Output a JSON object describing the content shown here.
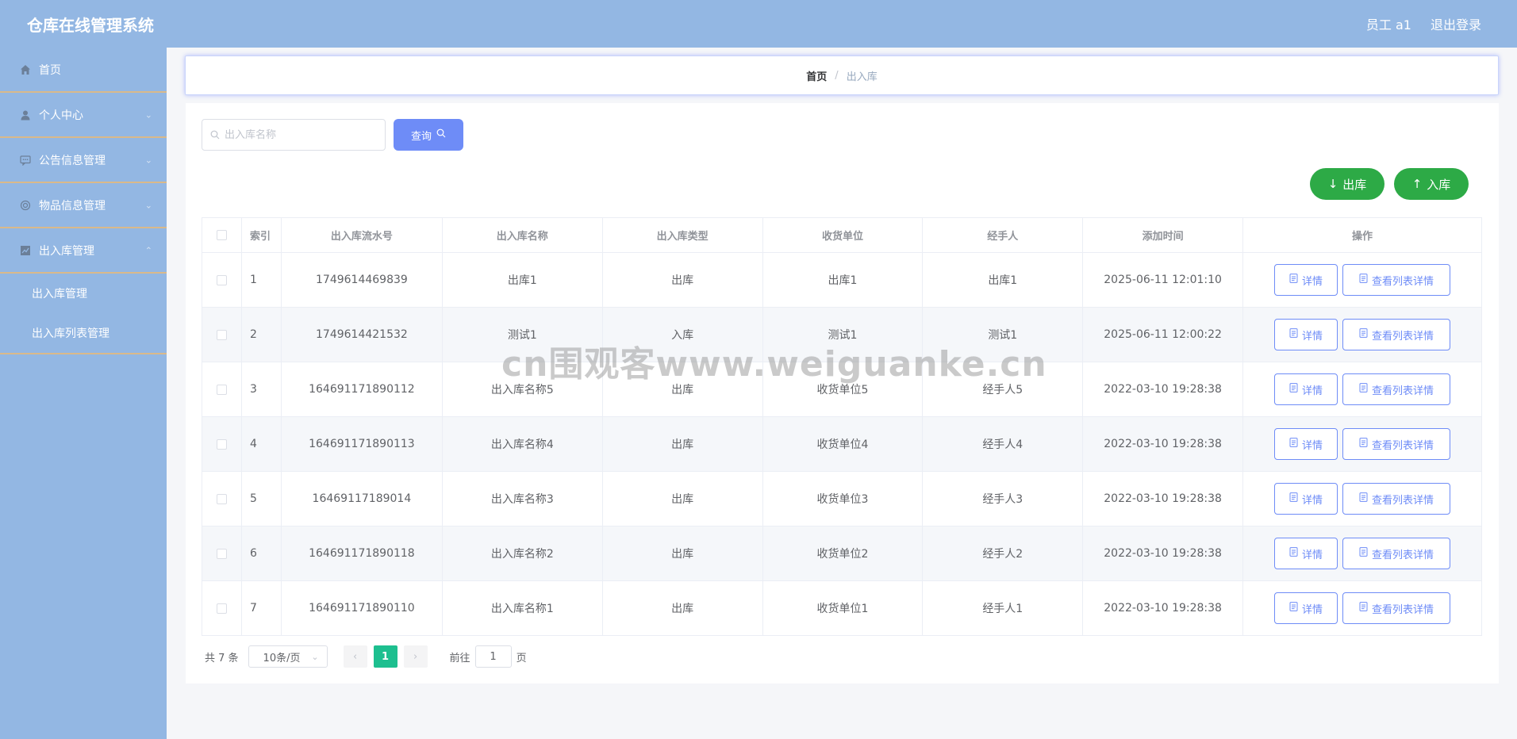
{
  "app": {
    "title": "仓库在线管理系统"
  },
  "header": {
    "user_label": "员工 a1",
    "logout_label": "退出登录"
  },
  "sidebar": {
    "items": [
      {
        "label": "首页",
        "icon": "home-icon"
      },
      {
        "label": "个人中心",
        "icon": "user-icon"
      },
      {
        "label": "公告信息管理",
        "icon": "chat-icon"
      },
      {
        "label": "物品信息管理",
        "icon": "gear-icon"
      },
      {
        "label": "出入库管理",
        "icon": "chart-icon"
      }
    ],
    "subitems": [
      {
        "label": "出入库管理"
      },
      {
        "label": "出入库列表管理"
      }
    ]
  },
  "breadcrumb": {
    "home": "首页",
    "separator": "/",
    "current": "出入库"
  },
  "search": {
    "placeholder": "出入库名称",
    "button_label": "查询"
  },
  "actions": {
    "out_label": "出库",
    "in_label": "入库"
  },
  "table": {
    "headers": [
      "索引",
      "出入库流水号",
      "出入库名称",
      "出入库类型",
      "收货单位",
      "经手人",
      "添加时间",
      "操作"
    ],
    "rows": [
      {
        "index": "1",
        "serial": "1749614469839",
        "name": "出库1",
        "type": "出库",
        "unit": "出库1",
        "handler": "出库1",
        "time": "2025-06-11 12:01:10"
      },
      {
        "index": "2",
        "serial": "1749614421532",
        "name": "测试1",
        "type": "入库",
        "unit": "测试1",
        "handler": "测试1",
        "time": "2025-06-11 12:00:22"
      },
      {
        "index": "3",
        "serial": "164691171890112",
        "name": "出入库名称5",
        "type": "出库",
        "unit": "收货单位5",
        "handler": "经手人5",
        "time": "2022-03-10 19:28:38"
      },
      {
        "index": "4",
        "serial": "164691171890113",
        "name": "出入库名称4",
        "type": "出库",
        "unit": "收货单位4",
        "handler": "经手人4",
        "time": "2022-03-10 19:28:38"
      },
      {
        "index": "5",
        "serial": "16469117189014",
        "name": "出入库名称3",
        "type": "出库",
        "unit": "收货单位3",
        "handler": "经手人3",
        "time": "2022-03-10 19:28:38"
      },
      {
        "index": "6",
        "serial": "164691171890118",
        "name": "出入库名称2",
        "type": "出库",
        "unit": "收货单位2",
        "handler": "经手人2",
        "time": "2022-03-10 19:28:38"
      },
      {
        "index": "7",
        "serial": "164691171890110",
        "name": "出入库名称1",
        "type": "出库",
        "unit": "收货单位1",
        "handler": "经手人1",
        "time": "2022-03-10 19:28:38"
      }
    ],
    "detail_label": "详情",
    "list_detail_label": "查看列表详情"
  },
  "pagination": {
    "total_text": "共 7 条",
    "page_size": "10条/页",
    "current_page": "1",
    "goto_label": "前往",
    "goto_value": "1",
    "page_suffix": "页"
  },
  "watermark": "cn围观客www.weiguanke.cn",
  "colors": {
    "header_bg": "#93b7e3",
    "primary": "#6e8cf7",
    "green": "#2daa46",
    "page_active": "#1dbf8f"
  }
}
